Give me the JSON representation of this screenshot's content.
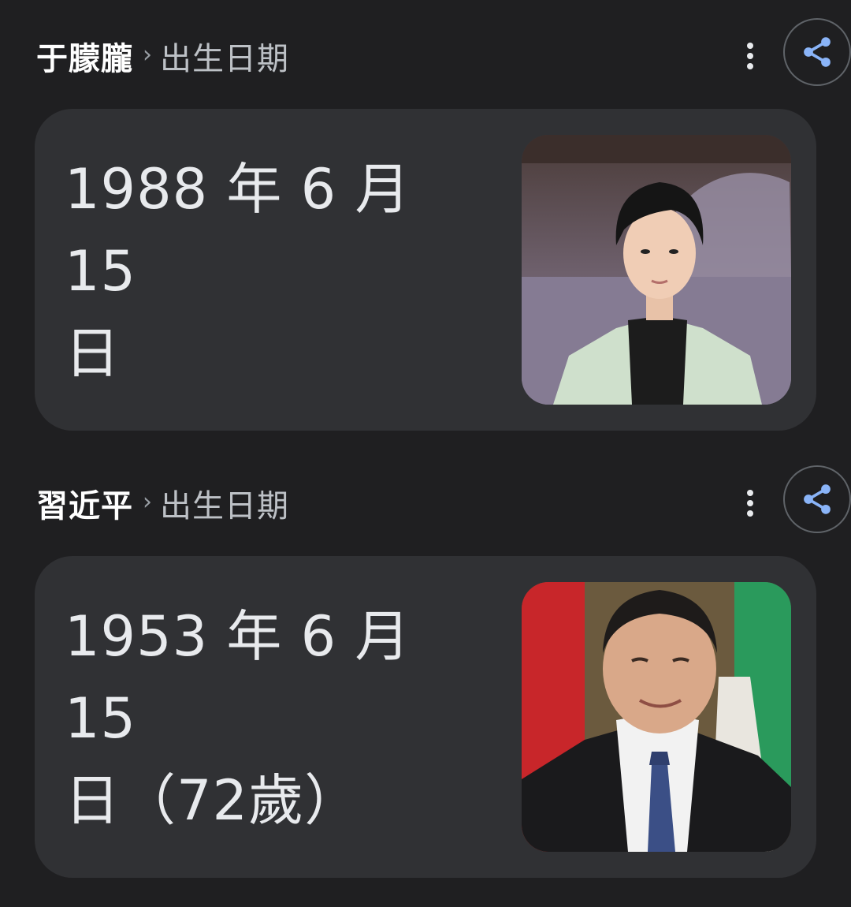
{
  "results": [
    {
      "breadcrumb": {
        "entity": "于朦朧",
        "separator": "›",
        "attribute": "出生日期"
      },
      "answer": {
        "line1": "1988 年 6 月 15",
        "line2": "日"
      },
      "image": {
        "alt": "于朦朧"
      },
      "icons": {
        "more": "more-vert-icon",
        "share": "share-icon"
      }
    },
    {
      "breadcrumb": {
        "entity": "習近平",
        "separator": "›",
        "attribute": "出生日期"
      },
      "answer": {
        "line1": "1953 年 6 月 15",
        "line2": "日（72歲）"
      },
      "image": {
        "alt": "習近平"
      },
      "icons": {
        "more": "more-vert-icon",
        "share": "share-icon"
      }
    }
  ],
  "colors": {
    "background": "#1f1f21",
    "card": "#303134",
    "share_accent": "#8ab4f8"
  }
}
